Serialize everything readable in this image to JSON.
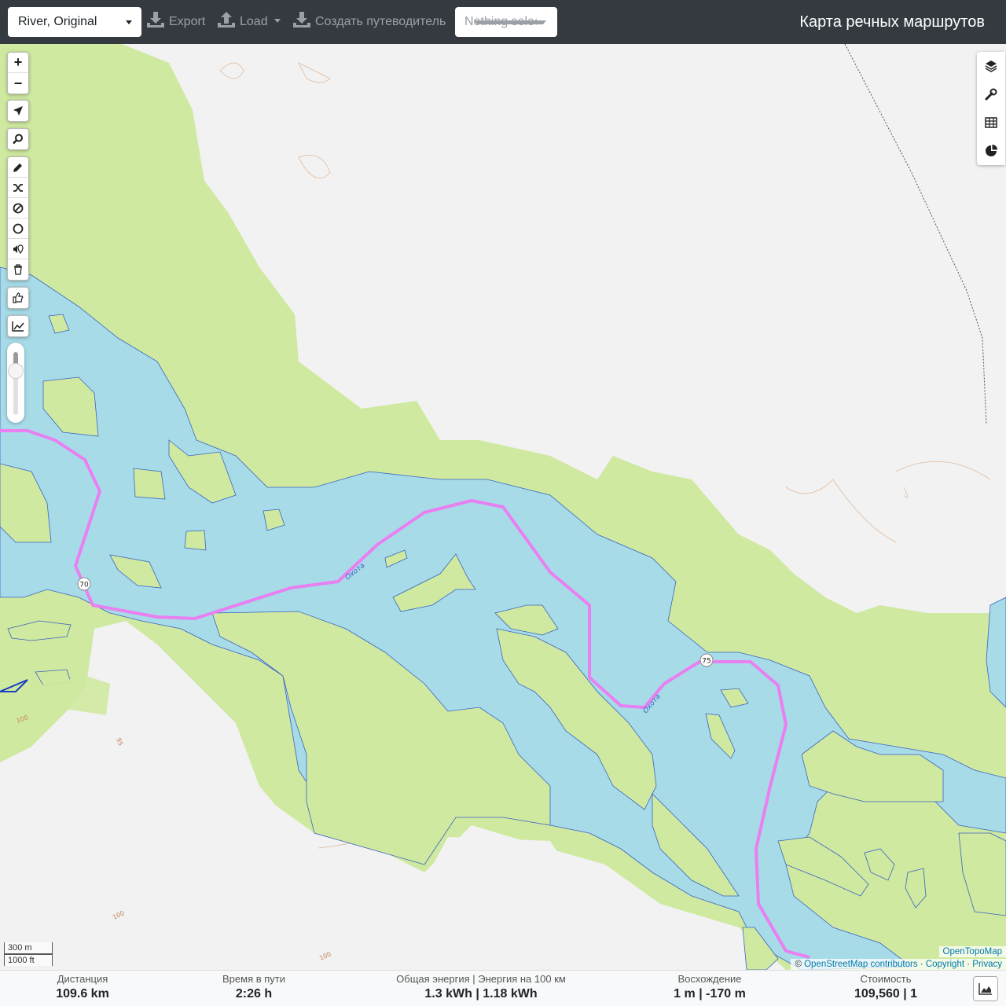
{
  "header": {
    "profile_select": "River, Original",
    "export_label": "Export",
    "load_label": "Load",
    "guide_label": "Создать путеводитель",
    "nothing_selected": "Nothing selected",
    "app_title": "Карта речных маршрутов"
  },
  "map": {
    "river_label": "Охота",
    "km_markers": [
      "70",
      "75"
    ],
    "contour_labels": [
      "100",
      "95",
      "100",
      "100"
    ],
    "scale_metric": "300 m",
    "scale_imperial": "1000 ft",
    "attribution_top": "OpenTopoMap",
    "attribution_osm": "OpenStreetMap contributors",
    "attribution_copyright": "Copyright",
    "attribution_privacy": "Privacy",
    "attribution_sep": "·",
    "colors": {
      "water": "#a7dbe8",
      "forest": "#cfe9a0",
      "route": "#e97ff0",
      "land": "#f2f2f2"
    }
  },
  "controls": {
    "zoom_in": "+",
    "zoom_out": "−",
    "icons": [
      "locate-icon",
      "search-icon",
      "pencil-icon",
      "shuffle-icon",
      "no-go-icon",
      "circle-icon",
      "poi-icon",
      "trash-icon",
      "thumb-icon",
      "elevation-icon"
    ],
    "right_icons": [
      "layers-icon",
      "wrench-icon",
      "table-icon",
      "pie-chart-icon"
    ]
  },
  "stats": {
    "distance_label": "Дистанция",
    "distance_value": "109.6 km",
    "time_label": "Время в пути",
    "time_value": "2:26 h",
    "energy_label": "Общая энергия | Энергия на 100 км",
    "energy_value": "1.3 kWh | 1.18 kWh",
    "ascent_label": "Восхождение",
    "ascent_value": "1 m | -170 m",
    "cost_label": "Стоимость",
    "cost_value": "109,560 | 1"
  }
}
